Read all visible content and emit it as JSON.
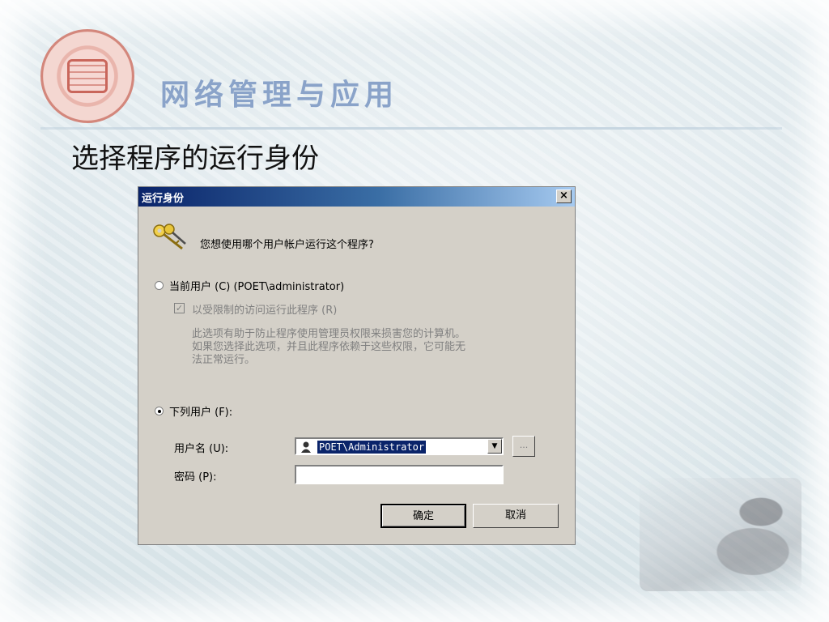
{
  "slide": {
    "course_title": "网络管理与应用",
    "heading": "选择程序的运行身份"
  },
  "dialog": {
    "title": "运行身份",
    "close_label": "×",
    "question": "您想使用哪个用户帐户运行这个程序?",
    "current_user": {
      "label": "当前用户 (C)  (POET\\administrator)",
      "selected": false
    },
    "restricted_access": {
      "label": "以受限制的访问运行此程序 (R)",
      "checked": true,
      "enabled": false
    },
    "description_lines": [
      "此选项有助于防止程序使用管理员权限来损害您的计算机。",
      "如果您选择此选项，并且此程序依赖于这些权限，它可能无",
      "法正常运行。"
    ],
    "following_user": {
      "label": "下列用户 (F):",
      "selected": true
    },
    "username_label": "用户名 (U):",
    "username_value": "POET\\Administrator",
    "browse_label": "...",
    "password_label": "密码 (P):",
    "password_value": "",
    "ok_label": "确定",
    "cancel_label": "取消"
  },
  "colors": {
    "titlebar_start": "#0a246a",
    "dialog_face": "#d4d0c8",
    "course_title": "#8aa3c9"
  },
  "icons": [
    "university-seal-logo",
    "keys-icon",
    "user-icon",
    "dropdown-arrow-icon",
    "close-icon"
  ]
}
